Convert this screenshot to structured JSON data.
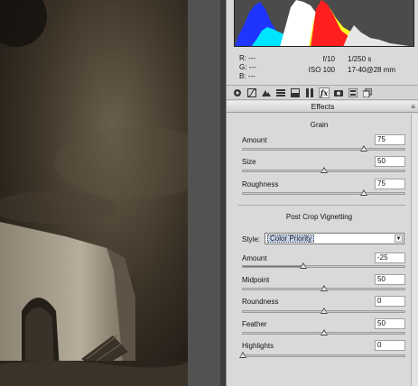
{
  "info": {
    "r": "R:  ---",
    "g": "G:  ---",
    "b": "B:  ---",
    "aperture": "f/10",
    "shutter": "1/250 s",
    "iso": "ISO 100",
    "lens": "17-40@28 mm"
  },
  "toolbar": {
    "icons": [
      "basic-icon",
      "tone-curve-icon",
      "detail-icon",
      "hsl-icon",
      "split-toning-icon",
      "lens-corrections-icon",
      "effects-icon",
      "camera-calibration-icon",
      "presets-icon",
      "snapshots-icon"
    ],
    "active": "effects-icon"
  },
  "panel": {
    "title": "Effects",
    "menu_glyph": "≡"
  },
  "grain": {
    "title": "Grain",
    "sliders": [
      {
        "label": "Amount",
        "value": "75",
        "fraction": 0.75
      },
      {
        "label": "Size",
        "value": "50",
        "fraction": 0.5
      },
      {
        "label": "Roughness",
        "value": "75",
        "fraction": 0.75
      }
    ]
  },
  "vignetting": {
    "title": "Post Crop Vignetting",
    "style_label": "Style:",
    "style_value": "Color Priority",
    "sliders": [
      {
        "label": "Amount",
        "value": "-25",
        "fraction": 0.375
      },
      {
        "label": "Midpoint",
        "value": "50",
        "fraction": 0.5
      },
      {
        "label": "Roundness",
        "value": "0",
        "fraction": 0.5
      },
      {
        "label": "Feather",
        "value": "50",
        "fraction": 0.5
      },
      {
        "label": "Highlights",
        "value": "0",
        "fraction": 0.0
      }
    ]
  },
  "colors": {
    "panel_bg": "#d9d9d9",
    "photo_tone": "#2e271e"
  }
}
